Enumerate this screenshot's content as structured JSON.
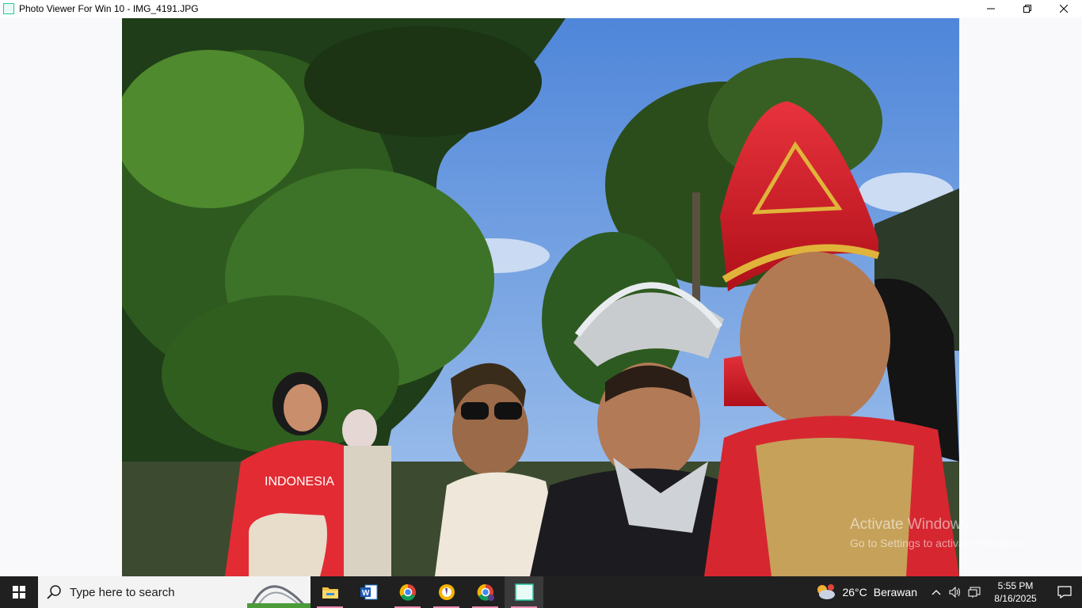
{
  "window": {
    "title": "Photo Viewer For Win 10 - IMG_4191.JPG",
    "icons": {
      "app": "photo-viewer-app-icon",
      "minimize": "minimize-icon",
      "restore": "restore-icon",
      "close": "close-icon"
    }
  },
  "watermark": {
    "line1": "Activate Windows",
    "line2": "Go to Settings to activate Windows."
  },
  "photo": {
    "file": "IMG_4191.JPG",
    "shirt_text": "INDONESIA"
  },
  "taskbar": {
    "search_placeholder": "Type here to search",
    "apps": [
      {
        "name": "File Explorer",
        "icon": "file-explorer-icon",
        "pinned": true
      },
      {
        "name": "Word",
        "icon": "word-icon",
        "pinned": false
      },
      {
        "name": "Chrome",
        "icon": "chrome-icon",
        "pinned": true
      },
      {
        "name": "Chrome profile",
        "icon": "chrome-profile-icon",
        "pinned": true
      },
      {
        "name": "Chrome profile 2",
        "icon": "chrome-profile2-icon",
        "pinned": true
      },
      {
        "name": "Photo Viewer",
        "icon": "photo-viewer-icon",
        "pinned": true,
        "active": true
      }
    ],
    "weather": {
      "temp": "26°C",
      "condition": "Berawan"
    },
    "clock": {
      "time": "5:55 PM",
      "date": "8/16/2025"
    }
  },
  "colors": {
    "taskbar": "#202020",
    "accent": "#f08fb5",
    "titlebar": "#ffffff"
  }
}
